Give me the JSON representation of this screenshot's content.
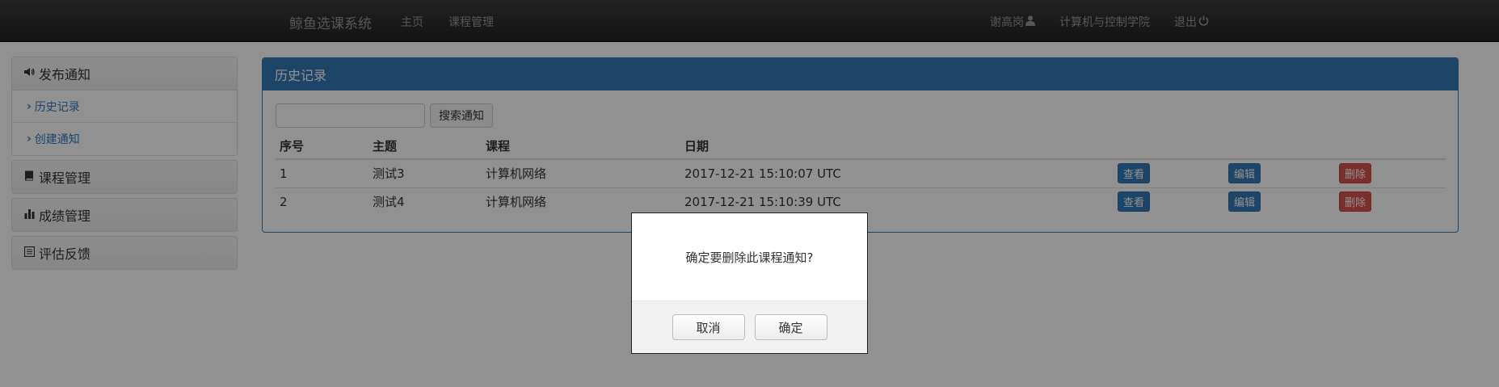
{
  "navbar": {
    "brand": "鲸鱼选课系统",
    "links": {
      "home": "主页",
      "course_mgmt": "课程管理"
    },
    "user": {
      "name": "谢高岗",
      "icon": "user-icon"
    },
    "college": "计算机与控制学院",
    "logout": {
      "label": "退出",
      "icon": "power-icon"
    }
  },
  "sidebar": {
    "notice": {
      "label": "发布通知",
      "icon": "volume-icon",
      "items": [
        {
          "label": "历史记录"
        },
        {
          "label": "创建通知"
        }
      ]
    },
    "course": {
      "label": "课程管理",
      "icon": "book-icon"
    },
    "grade": {
      "label": "成绩管理",
      "icon": "stats-icon"
    },
    "feedback": {
      "label": "评估反馈",
      "icon": "list-icon"
    }
  },
  "panel": {
    "title": "历史记录",
    "search": {
      "value": "",
      "button": "搜索通知"
    },
    "headers": {
      "index": "序号",
      "subject": "主题",
      "course": "课程",
      "date": "日期"
    },
    "rows": [
      {
        "index": "1",
        "subject": "测试3",
        "course": "计算机网络",
        "date": "2017-12-21 15:10:07 UTC",
        "view": "查看",
        "edit": "编辑",
        "delete": "删除"
      },
      {
        "index": "2",
        "subject": "测试4",
        "course": "计算机网络",
        "date": "2017-12-21 15:10:39 UTC",
        "view": "查看",
        "edit": "编辑",
        "delete": "删除"
      }
    ]
  },
  "modal": {
    "message": "确定要删除此课程通知?",
    "cancel": "取消",
    "confirm": "确定"
  },
  "colors": {
    "primary": "#337ab7",
    "danger": "#d9534f",
    "navbar": "#2b2b2b"
  }
}
